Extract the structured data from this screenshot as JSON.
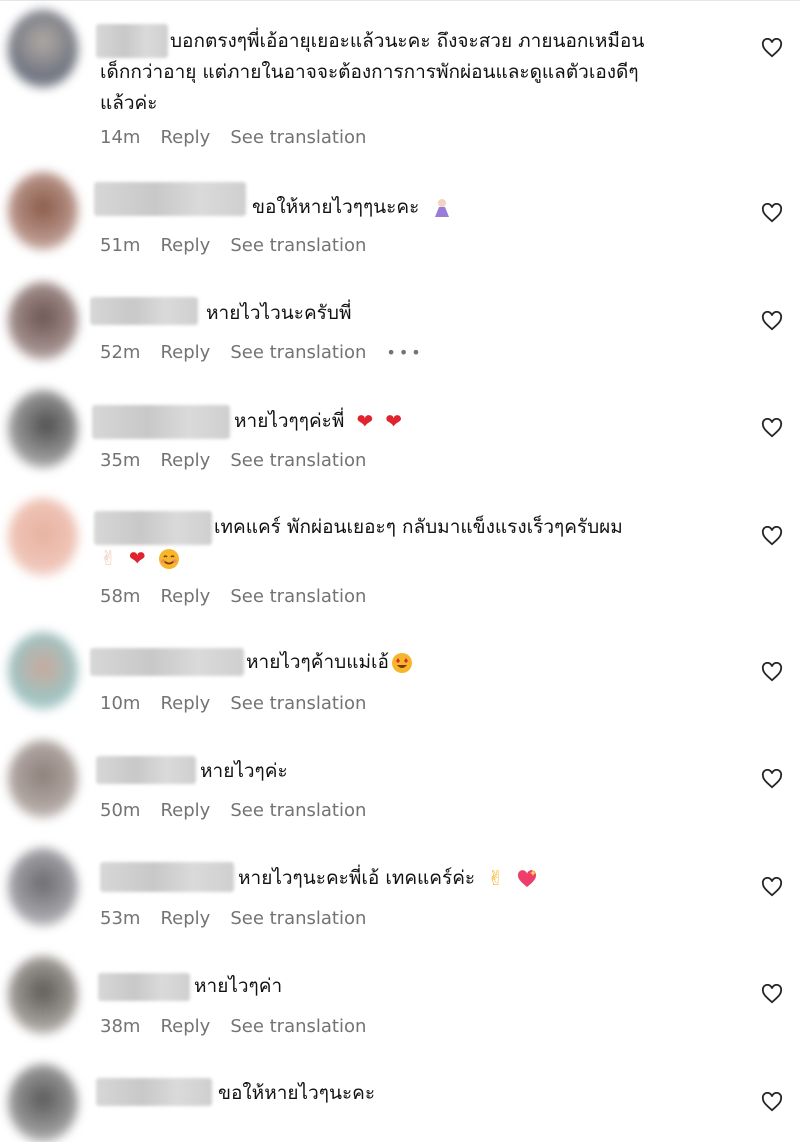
{
  "comments": [
    {
      "avatar_color": "#8c8f99",
      "text_lines": [
        "บอกตรงๆพี่เอ้อายุเยอะแล้วนะคะ ถึงจะสวย ภายนอกเหมือน",
        "เด็กกว่าอายุ แต่ภายในอาจจะต้องการการพักผ่อนและดูแลตัวเองดีๆ",
        "แล้วค่ะ"
      ],
      "time": "14m",
      "reply": "Reply",
      "translate": "See translation",
      "emoji": []
    },
    {
      "avatar_color": "#a07868",
      "text_lines": [
        "ขอให้หายไวๆๆนะคะ"
      ],
      "time": "51m",
      "reply": "Reply",
      "translate": "See translation",
      "emoji": [
        "bow-emoji"
      ]
    },
    {
      "avatar_color": "#8c7470",
      "text_lines": [
        "หายไวไวนะครับพี่"
      ],
      "time": "52m",
      "reply": "Reply",
      "translate": "See translation",
      "more": "•••",
      "emoji": []
    },
    {
      "avatar_color": "#6e6e6e",
      "text_lines": [
        "หายไวๆๆค่ะพี่"
      ],
      "time": "35m",
      "reply": "Reply",
      "translate": "See translation",
      "emoji": [
        "red-heart-emoji",
        "red-heart-emoji"
      ]
    },
    {
      "avatar_color": "#e3a89a",
      "text_lines": [
        "เทคแคร์ พักผ่อนเยอะๆ กลับมาแข็งแรงเร็วๆครับผม",
        ""
      ],
      "time": "58m",
      "reply": "Reply",
      "translate": "See translation",
      "emoji": [
        "peace-hand-emoji",
        "red-heart-emoji",
        "smiling-face-emoji"
      ]
    },
    {
      "avatar_color": "#a8c2c0",
      "text_lines": [
        "หายไวๆค้าบแม่เอ้"
      ],
      "time": "10m",
      "reply": "Reply",
      "translate": "See translation",
      "emoji": [
        "heart-eyes-emoji"
      ]
    },
    {
      "avatar_color": "#9a8f8a",
      "text_lines": [
        "หายไวๆค่ะ"
      ],
      "time": "50m",
      "reply": "Reply",
      "translate": "See translation",
      "emoji": []
    },
    {
      "avatar_color": "#8b8b8f",
      "text_lines": [
        "หายไวๆนะคะพี่เอ้ เทคแคร์ค่ะ"
      ],
      "time": "53m",
      "reply": "Reply",
      "translate": "See translation",
      "emoji": [
        "victory-hand-emoji",
        "sparkling-heart-emoji"
      ]
    },
    {
      "avatar_color": "#8a8580",
      "text_lines": [
        "หายไวๆค่า"
      ],
      "time": "38m",
      "reply": "Reply",
      "translate": "See translation",
      "emoji": []
    },
    {
      "avatar_color": "#7d7d7d",
      "text_lines": [
        "ขอให้หายไวๆนะคะ"
      ],
      "time": "",
      "reply": "",
      "translate": "",
      "emoji": []
    }
  ],
  "colors": {
    "meta": "#737373",
    "heart_stroke": "#262626",
    "emoji_red": "#e0242f"
  }
}
